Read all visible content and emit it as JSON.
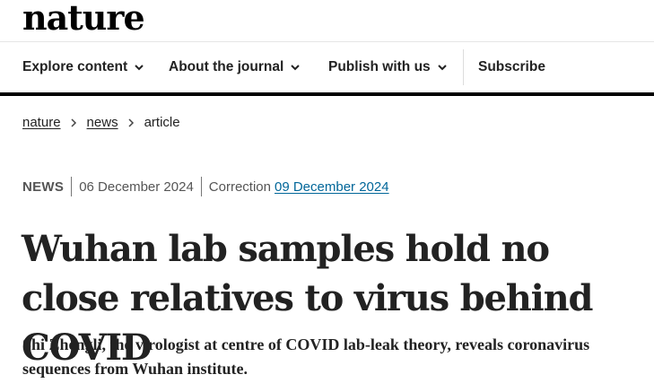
{
  "site": {
    "logo": "nature"
  },
  "nav": {
    "items": [
      {
        "label": "Explore content",
        "icon": "chevron-down-icon"
      },
      {
        "label": "About the journal",
        "icon": "chevron-down-icon"
      },
      {
        "label": "Publish with us",
        "icon": "chevron-down-icon"
      }
    ],
    "subscribe_label": "Subscribe"
  },
  "breadcrumb": {
    "items": [
      "nature",
      "news",
      "article"
    ],
    "separator_icon": "chevron-right-icon"
  },
  "article": {
    "type": "NEWS",
    "published": "06 December 2024",
    "correction_label": "Correction",
    "correction_date": "09 December 2024",
    "title": "Wuhan lab samples hold no close relatives to virus behind COVID",
    "standfirst": "Shi Zhengli, the virologist at centre of COVID lab-leak theory, reveals coronavirus sequences from Wuhan institute."
  },
  "colors": {
    "link_accent": "#006699",
    "nav_rule": "#000000",
    "text": "#222222"
  }
}
